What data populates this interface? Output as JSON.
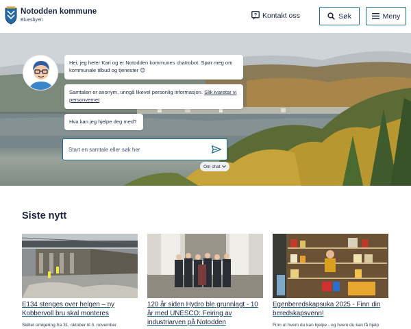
{
  "header": {
    "logo_name": "Notodden kommune",
    "logo_sub": "Bluesbyen",
    "contact_label": "Kontakt oss",
    "search_label": "Søk",
    "menu_label": "Meny",
    "accent_color": "#1b6f8a"
  },
  "chat": {
    "greeting": "Hei, jeg heter Kari og er Notodden kommunes chatrobot. Spør meg om kommunale tilbud og tjenester 😊",
    "privacy_text": "Samtalen er anonym, unngå likevel personlig informasjon. ",
    "privacy_link": "Slik ivaretar vi personvernet",
    "question": "Hva kan jeg hjelpe deg med?",
    "input_placeholder": "Start en samtale eller søk her",
    "about_label": "Om chat"
  },
  "news": {
    "heading": "Siste nytt",
    "items": [
      {
        "title": "E134 stenges over helgen – ny Kobbervoll bru skal monteres",
        "desc": "Skiltet omkjøring fra 31. oktober til 3. november"
      },
      {
        "title": "120 år siden Hydro ble grunnlagt - 10 år med UNESCO: Feiring av industriarven på Notodden",
        "desc": ""
      },
      {
        "title": "Egenberedskapsuka 2025 - Finn din beredskapsvenn!",
        "desc": "Finn ut hvem du kan hjelpe - og hvem du kan få hjelp"
      }
    ]
  }
}
